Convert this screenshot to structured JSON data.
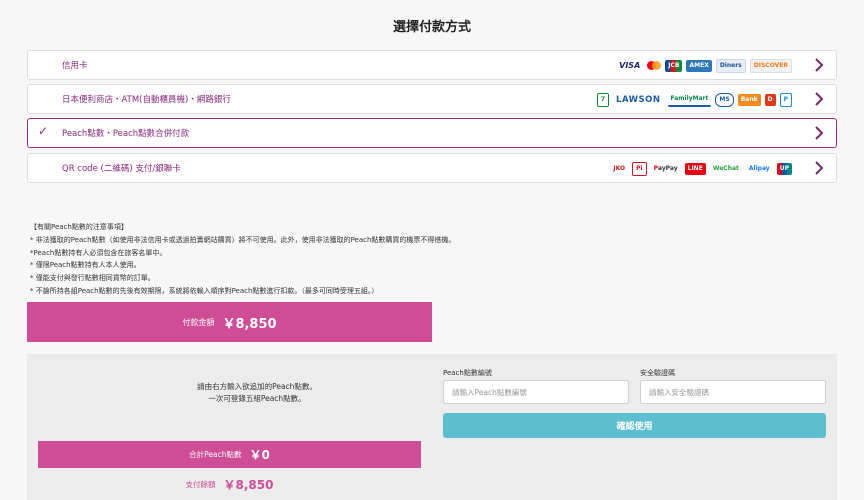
{
  "page_title": "選擇付款方式",
  "payment_options": [
    {
      "label": "信用卡",
      "selected": false,
      "logos": [
        {
          "name": "visa-logo",
          "text": "VISA",
          "cls": "visa"
        },
        {
          "name": "mastercard-logo",
          "text": "",
          "cls": "mc"
        },
        {
          "name": "jcb-logo",
          "text": "JCB",
          "cls": "jcb"
        },
        {
          "name": "amex-logo",
          "text": "AMEX",
          "cls": "amex"
        },
        {
          "name": "diners-logo",
          "text": "Diners",
          "cls": "diners"
        },
        {
          "name": "discover-logo",
          "text": "DISCOVER",
          "cls": "discover"
        }
      ]
    },
    {
      "label": "日本便利商店・ATM(自動櫃員機)・網路銀行",
      "selected": false,
      "logos": [
        {
          "name": "seven-eleven-logo",
          "text": "7",
          "cls": "s711"
        },
        {
          "name": "lawson-logo",
          "text": "LAWSON",
          "cls": "lawson"
        },
        {
          "name": "familymart-logo",
          "text": "FamilyMart",
          "cls": "fmart"
        },
        {
          "name": "ministop-logo",
          "text": "MS",
          "cls": "ok"
        },
        {
          "name": "bank-logo",
          "text": "Bank",
          "cls": "bank"
        },
        {
          "name": "daily-logo",
          "text": "D",
          "cls": "dd"
        },
        {
          "name": "payeasy-logo",
          "text": "P",
          "cls": "pp"
        }
      ]
    },
    {
      "label": "Peach點數・Peach點數合併付款",
      "selected": true,
      "logos": []
    },
    {
      "label": "QR code (二維碼) 支付/銀聯卡",
      "selected": false,
      "logos": [
        {
          "name": "jkopay-logo",
          "text": "JKO",
          "cls": "jkopay"
        },
        {
          "name": "pi-logo",
          "text": "Pi",
          "cls": "pi"
        },
        {
          "name": "paypay-logo",
          "text": "PayPay",
          "cls": "paypay"
        },
        {
          "name": "line-pay-logo",
          "text": "LINE",
          "cls": "red"
        },
        {
          "name": "wechat-pay-logo",
          "text": "WeChat",
          "cls": "wechat"
        },
        {
          "name": "alipay-logo",
          "text": "Alipay",
          "cls": "alipay"
        },
        {
          "name": "unionpay-logo",
          "text": "UP",
          "cls": "union"
        }
      ]
    }
  ],
  "notes": [
    "【有關Peach點數的注意事項】",
    "* 非法獲取的Peach點數（如使用非法信用卡或透過拍賣網站購買）將不可使用。此外，使用非法獲取的Peach點數購買的機票不得搭機。",
    "*Peach點數持有人必須包含在旅客名單中。",
    "* 僅限Peach點數持有人本人使用。",
    "* 僅能支付與發行點數相同貨幣的訂單。",
    "* 不論所持各組Peach點數的先後有效期限，系統將依輸入順序對Peach點數進行扣款。（最多可同時受理五組。）"
  ],
  "payment_total": {
    "label": "付款金額",
    "value": "￥8,850"
  },
  "peach_panel": {
    "instruction_line1": "請由右方輸入欲追加的Peach點數。",
    "instruction_line2": "一次可登錄五組Peach點數。",
    "points_number_label": "Peach點數編號",
    "points_number_placeholder": "請輸入Peach點數編號",
    "security_code_label": "安全驗證碼",
    "security_code_placeholder": "請輸入安全驗證碼",
    "confirm_label": "確認使用",
    "peach_total_label": "合計Peach點數",
    "peach_total_value": "￥0",
    "pay_amount_label": "支付餘額",
    "pay_amount_value": "￥8,850"
  },
  "colors": {
    "accent": "#9b2d8c",
    "pink": "#cf4d96",
    "teal": "#5bbfcf"
  }
}
